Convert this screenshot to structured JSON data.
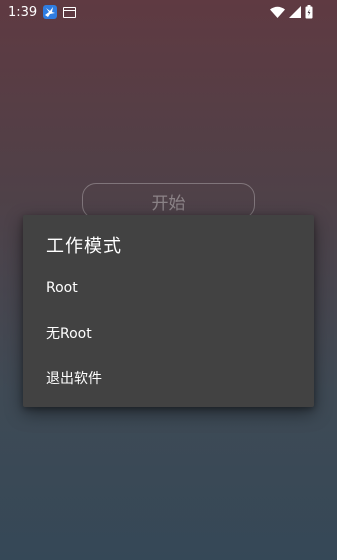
{
  "status_bar": {
    "time": "1:39"
  },
  "background_button": {
    "label": "开始"
  },
  "dialog": {
    "title": "工作模式",
    "options": [
      {
        "label": "Root"
      },
      {
        "label": "无Root"
      },
      {
        "label": "退出软件"
      }
    ]
  },
  "colors": {
    "dialog_bg": "#424242",
    "app_icon_blue": "#2f7de1"
  },
  "icons": {
    "app_notification": "bird-icon",
    "window": "window-icon",
    "wifi": "wifi-icon",
    "signal": "signal-icon",
    "battery": "battery-icon"
  }
}
